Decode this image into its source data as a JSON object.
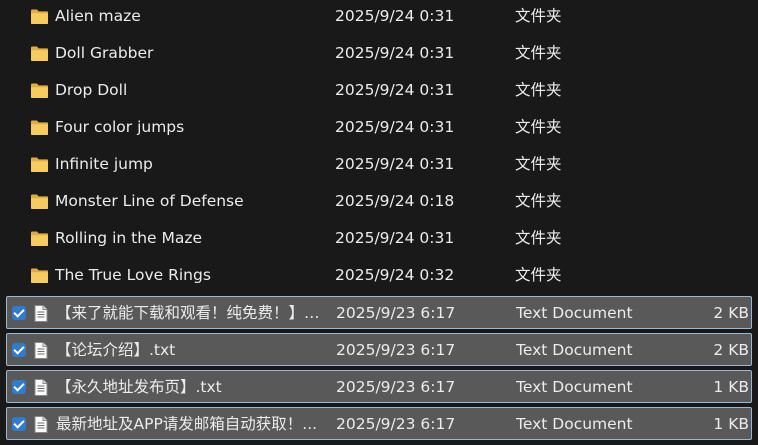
{
  "rows": [
    {
      "name": "Alien maze",
      "date": "2025/9/24 0:31",
      "type": "文件夹",
      "size": "",
      "kind": "folder",
      "selected": false,
      "icon": "folder-icon"
    },
    {
      "name": "Doll Grabber",
      "date": "2025/9/24 0:31",
      "type": "文件夹",
      "size": "",
      "kind": "folder",
      "selected": false,
      "icon": "folder-icon"
    },
    {
      "name": "Drop Doll",
      "date": "2025/9/24 0:31",
      "type": "文件夹",
      "size": "",
      "kind": "folder",
      "selected": false,
      "icon": "folder-icon"
    },
    {
      "name": "Four color jumps",
      "date": "2025/9/24 0:31",
      "type": "文件夹",
      "size": "",
      "kind": "folder",
      "selected": false,
      "icon": "folder-icon"
    },
    {
      "name": "Infinite jump",
      "date": "2025/9/24 0:31",
      "type": "文件夹",
      "size": "",
      "kind": "folder",
      "selected": false,
      "icon": "folder-icon"
    },
    {
      "name": "Monster Line of Defense",
      "date": "2025/9/24 0:18",
      "type": "文件夹",
      "size": "",
      "kind": "folder",
      "selected": false,
      "icon": "folder-icon"
    },
    {
      "name": "Rolling in the Maze",
      "date": "2025/9/24 0:31",
      "type": "文件夹",
      "size": "",
      "kind": "folder",
      "selected": false,
      "icon": "folder-icon"
    },
    {
      "name": "The True Love Rings",
      "date": "2025/9/24 0:32",
      "type": "文件夹",
      "size": "",
      "kind": "folder",
      "selected": false,
      "icon": "folder-icon"
    },
    {
      "name": "【来了就能下载和观看！纯免费！】.t...",
      "date": "2025/9/23 6:17",
      "type": "Text Document",
      "size": "2 KB",
      "kind": "file",
      "selected": true,
      "icon": "text-document-icon"
    },
    {
      "name": "【论坛介绍】.txt",
      "date": "2025/9/23 6:17",
      "type": "Text Document",
      "size": "2 KB",
      "kind": "file",
      "selected": true,
      "icon": "text-document-icon"
    },
    {
      "name": "【永久地址发布页】.txt",
      "date": "2025/9/23 6:17",
      "type": "Text Document",
      "size": "1 KB",
      "kind": "file",
      "selected": true,
      "icon": "text-document-icon"
    },
    {
      "name": "最新地址及APP请发邮箱自动获取！...",
      "date": "2025/9/23 6:17",
      "type": "Text Document",
      "size": "1 KB",
      "kind": "file",
      "selected": true,
      "icon": "text-document-icon"
    }
  ],
  "colors": {
    "background": "#191919",
    "text": "#ececec",
    "selection": "#595959",
    "selection_border": "#9ab8d2",
    "checkbox": "#2f7ccf",
    "folder": "#f2c75c"
  }
}
